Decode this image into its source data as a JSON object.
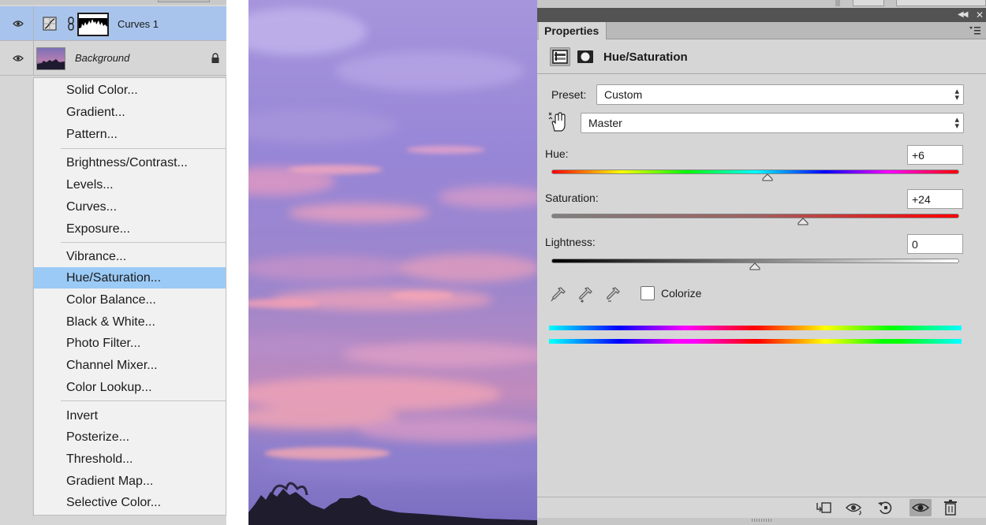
{
  "layers": [
    {
      "name": "Curves 1",
      "selected": true,
      "type": "adjustment"
    },
    {
      "name": "Background",
      "selected": false,
      "locked": true,
      "type": "image"
    }
  ],
  "adjustment_menu": {
    "groups": [
      [
        "Solid Color...",
        "Gradient...",
        "Pattern..."
      ],
      [
        "Brightness/Contrast...",
        "Levels...",
        "Curves...",
        "Exposure..."
      ],
      [
        "Vibrance...",
        "Hue/Saturation...",
        "Color Balance...",
        "Black & White...",
        "Photo Filter...",
        "Channel Mixer...",
        "Color Lookup..."
      ],
      [
        "Invert",
        "Posterize...",
        "Threshold...",
        "Gradient Map...",
        "Selective Color..."
      ]
    ],
    "highlighted": "Hue/Saturation..."
  },
  "properties": {
    "tab": "Properties",
    "title": "Hue/Saturation",
    "preset_label": "Preset:",
    "preset_value": "Custom",
    "channel_value": "Master",
    "hue_label": "Hue:",
    "hue_value": "+6",
    "hue_slider": 6,
    "saturation_label": "Saturation:",
    "saturation_value": "+24",
    "saturation_slider": 24,
    "lightness_label": "Lightness:",
    "lightness_value": "0",
    "lightness_slider": 0,
    "colorize_label": "Colorize",
    "colorize_checked": false
  },
  "footer_icons": [
    "clip-to-layer-icon",
    "view-previous-state-icon",
    "reset-icon",
    "toggle-visibility-icon",
    "delete-icon"
  ],
  "colors": {
    "selection": "#a9c4ec",
    "menu_highlight": "#9bcaf6",
    "panel": "#d6d6d6",
    "header": "#535353"
  }
}
